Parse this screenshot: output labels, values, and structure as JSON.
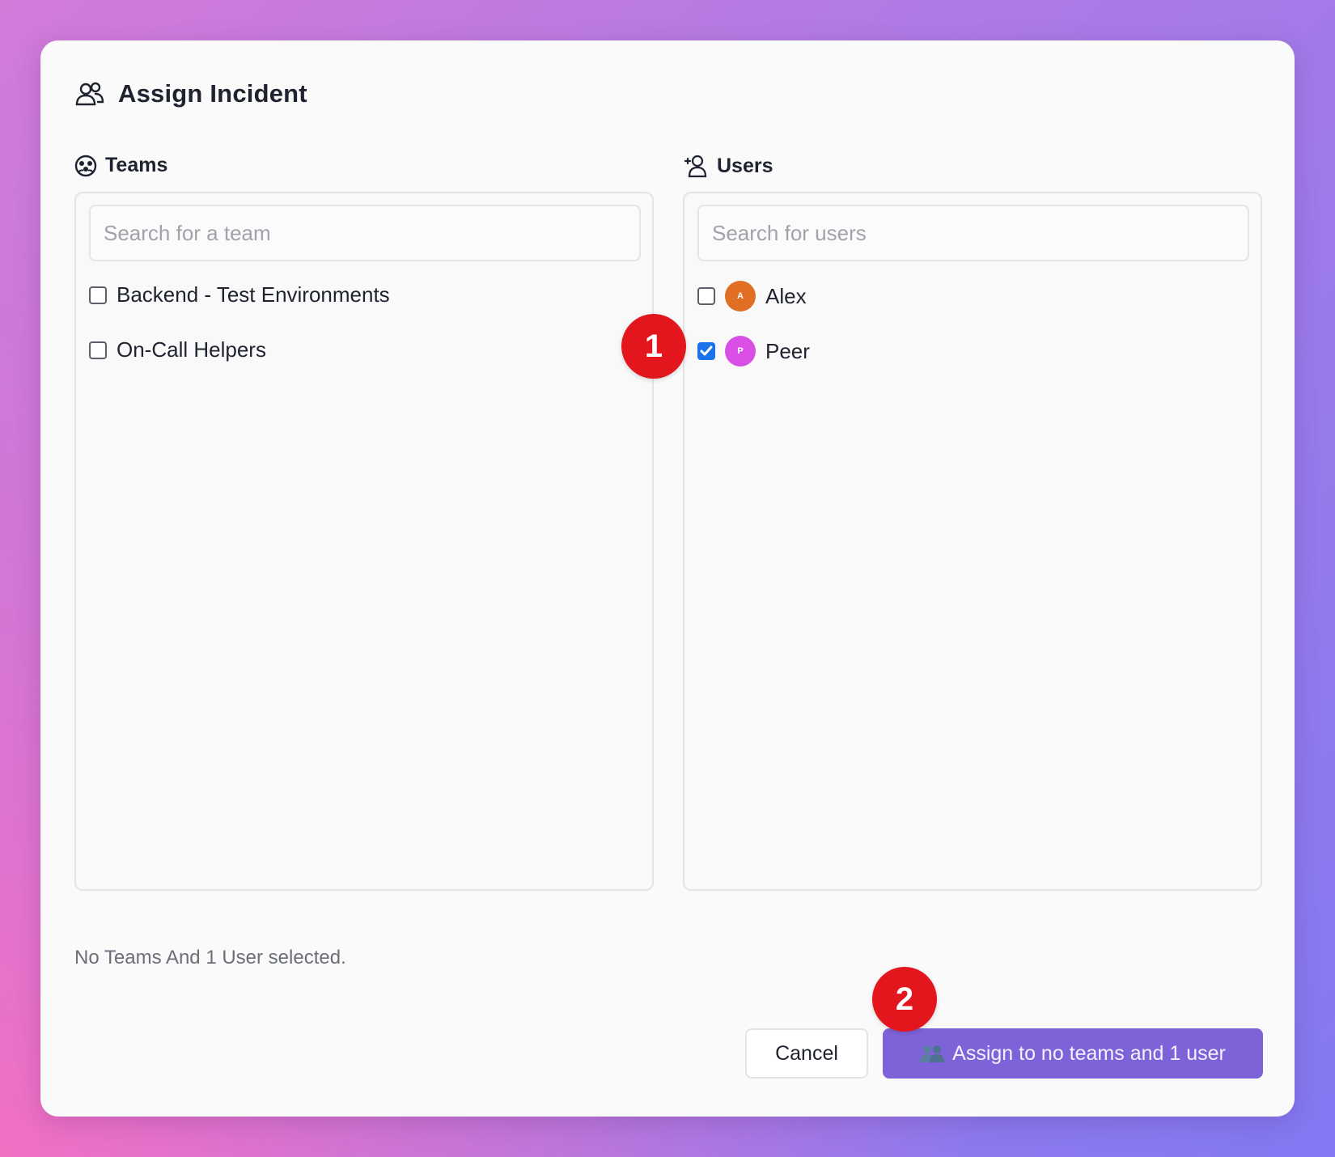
{
  "dialog": {
    "title": "Assign Incident"
  },
  "teams": {
    "label": "Teams",
    "search_placeholder": "Search for a team",
    "items": [
      {
        "label": "Backend - Test Environments",
        "checked": false
      },
      {
        "label": "On-Call Helpers",
        "checked": false
      }
    ]
  },
  "users": {
    "label": "Users",
    "search_placeholder": "Search for users",
    "items": [
      {
        "label": "Alex",
        "initial": "A",
        "avatar_color": "#e06f23",
        "checked": false
      },
      {
        "label": "Peer",
        "initial": "P",
        "avatar_color": "#d94fe6",
        "checked": true
      }
    ]
  },
  "summary": "No Teams And 1 User selected.",
  "buttons": {
    "cancel": "Cancel",
    "assign": "Assign to no teams and 1 user"
  },
  "badges": {
    "step1": "1",
    "step2": "2"
  },
  "colors": {
    "primary_button": "#7e63d8",
    "badge": "#e3161e",
    "checkbox_checked": "#1a73e8"
  }
}
